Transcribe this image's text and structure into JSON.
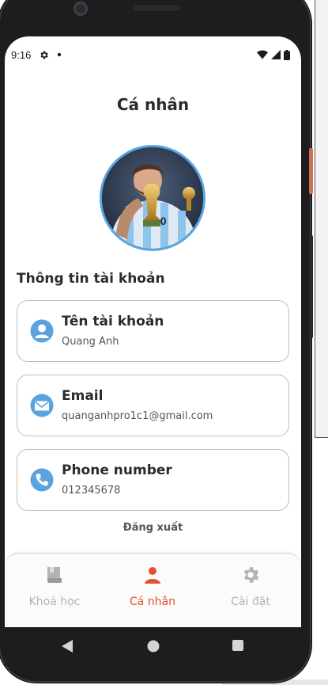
{
  "status_bar": {
    "time": "9:16",
    "left_icons": [
      "gear-icon",
      "dot-icon"
    ],
    "right_icons": [
      "wifi-icon",
      "signal-icon",
      "battery-icon"
    ]
  },
  "header": {
    "title": "Cá nhân"
  },
  "profile": {
    "avatar": "profile-photo"
  },
  "account_info": {
    "section_title": "Thông tin tài khoản",
    "cards": [
      {
        "label": "Tên tài khoản",
        "value": "Quang Anh",
        "icon": "user-icon"
      },
      {
        "label": "Email",
        "value": "quanganhpro1c1@gmail.com",
        "icon": "mail-icon"
      },
      {
        "label": "Phone number",
        "value": "012345678",
        "icon": "phone-icon"
      }
    ]
  },
  "logout": {
    "label": "Đăng xuất"
  },
  "bottom_nav": {
    "items": [
      {
        "label": "Khoá học",
        "icon": "book-icon",
        "active": false
      },
      {
        "label": "Cá nhân",
        "icon": "person-icon",
        "active": true
      },
      {
        "label": "Cài đặt",
        "icon": "gear-icon",
        "active": false
      }
    ]
  },
  "colors": {
    "accent": "#e0542d",
    "icon_blue": "#5aa3de",
    "avatar_ring": "#58a5df",
    "inactive": "#b3b3b3"
  }
}
